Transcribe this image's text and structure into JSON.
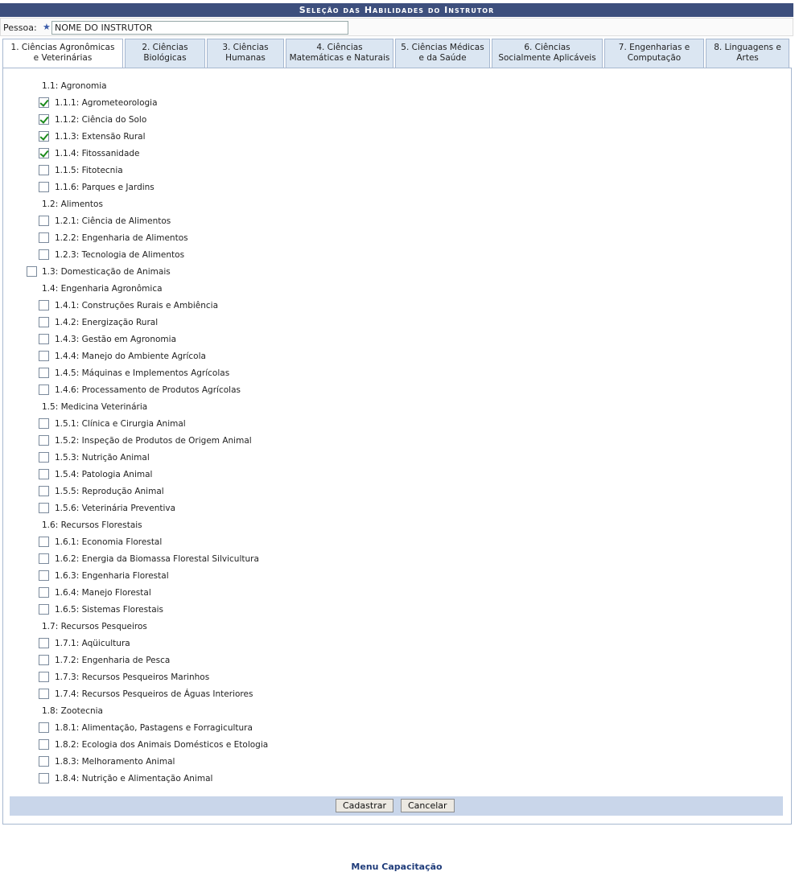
{
  "header": {
    "title": "Seleção das Habilidades do Instrutor"
  },
  "pessoa": {
    "label": "Pessoa:",
    "value": "NOME DO INSTRUTOR"
  },
  "tabs": [
    {
      "line1": "1. Ciências Agronômicas",
      "line2": "e Veterinárias",
      "active": true
    },
    {
      "line1": "2. Ciências",
      "line2": "Biológicas"
    },
    {
      "line1": "3. Ciências",
      "line2": "Humanas"
    },
    {
      "line1": "4. Ciências",
      "line2": "Matemáticas e Naturais"
    },
    {
      "line1": "5. Ciências Médicas",
      "line2": "e da Saúde"
    },
    {
      "line1": "6. Ciências",
      "line2": "Socialmente Aplicáveis"
    },
    {
      "line1": "7. Engenharias e",
      "line2": "Computação"
    },
    {
      "line1": "8. Linguagens e",
      "line2": "Artes"
    }
  ],
  "items": [
    {
      "label": "1.1: Agronomia",
      "kind": "group"
    },
    {
      "label": "1.1.1: Agrometeorologia",
      "kind": "item",
      "checked": true
    },
    {
      "label": "1.1.2: Ciência do Solo",
      "kind": "item",
      "checked": true
    },
    {
      "label": "1.1.3: Extensão Rural",
      "kind": "item",
      "checked": true
    },
    {
      "label": "1.1.4: Fitossanidade",
      "kind": "item",
      "checked": true
    },
    {
      "label": "1.1.5: Fitotecnia",
      "kind": "item",
      "checked": false
    },
    {
      "label": "1.1.6: Parques e Jardins",
      "kind": "item",
      "checked": false
    },
    {
      "label": "1.2: Alimentos",
      "kind": "group"
    },
    {
      "label": "1.2.1: Ciência de Alimentos",
      "kind": "item",
      "checked": false
    },
    {
      "label": "1.2.2: Engenharia de Alimentos",
      "kind": "item",
      "checked": false
    },
    {
      "label": "1.2.3: Tecnologia de Alimentos",
      "kind": "item",
      "checked": false
    },
    {
      "label": "1.3: Domesticação de Animais",
      "kind": "group-check",
      "checked": false
    },
    {
      "label": "1.4: Engenharia Agronômica",
      "kind": "group"
    },
    {
      "label": "1.4.1: Construções Rurais e Ambiência",
      "kind": "item",
      "checked": false
    },
    {
      "label": "1.4.2: Energização Rural",
      "kind": "item",
      "checked": false
    },
    {
      "label": "1.4.3: Gestão em Agronomia",
      "kind": "item",
      "checked": false
    },
    {
      "label": "1.4.4: Manejo do Ambiente Agrícola",
      "kind": "item",
      "checked": false
    },
    {
      "label": "1.4.5: Máquinas e Implementos Agrícolas",
      "kind": "item",
      "checked": false
    },
    {
      "label": "1.4.6: Processamento de Produtos Agrícolas",
      "kind": "item",
      "checked": false
    },
    {
      "label": "1.5: Medicina Veterinária",
      "kind": "group"
    },
    {
      "label": "1.5.1: Clínica e Cirurgia Animal",
      "kind": "item",
      "checked": false
    },
    {
      "label": "1.5.2: Inspeção de Produtos de Origem Animal",
      "kind": "item",
      "checked": false
    },
    {
      "label": "1.5.3: Nutrição Animal",
      "kind": "item",
      "checked": false
    },
    {
      "label": "1.5.4: Patologia Animal",
      "kind": "item",
      "checked": false
    },
    {
      "label": "1.5.5: Reprodução Animal",
      "kind": "item",
      "checked": false
    },
    {
      "label": "1.5.6: Veterinária Preventiva",
      "kind": "item",
      "checked": false
    },
    {
      "label": "1.6: Recursos Florestais",
      "kind": "group"
    },
    {
      "label": "1.6.1: Economia Florestal",
      "kind": "item",
      "checked": false
    },
    {
      "label": "1.6.2: Energia da Biomassa Florestal Silvicultura",
      "kind": "item",
      "checked": false
    },
    {
      "label": "1.6.3: Engenharia Florestal",
      "kind": "item",
      "checked": false
    },
    {
      "label": "1.6.4: Manejo Florestal",
      "kind": "item",
      "checked": false
    },
    {
      "label": "1.6.5: Sistemas Florestais",
      "kind": "item",
      "checked": false
    },
    {
      "label": "1.7: Recursos Pesqueiros",
      "kind": "group"
    },
    {
      "label": "1.7.1: Aqüicultura",
      "kind": "item",
      "checked": false
    },
    {
      "label": "1.7.2: Engenharia de Pesca",
      "kind": "item",
      "checked": false
    },
    {
      "label": "1.7.3: Recursos Pesqueiros Marinhos",
      "kind": "item",
      "checked": false
    },
    {
      "label": "1.7.4: Recursos Pesqueiros de Águas Interiores",
      "kind": "item",
      "checked": false
    },
    {
      "label": "1.8: Zootecnia",
      "kind": "group"
    },
    {
      "label": "1.8.1: Alimentação, Pastagens e Forragicultura",
      "kind": "item",
      "checked": false
    },
    {
      "label": "1.8.2: Ecologia dos Animais Domésticos e Etologia",
      "kind": "item",
      "checked": false
    },
    {
      "label": "1.8.3: Melhoramento Animal",
      "kind": "item",
      "checked": false
    },
    {
      "label": "1.8.4: Nutrição e Alimentação Animal",
      "kind": "item",
      "checked": false
    }
  ],
  "buttons": {
    "submit": "Cadastrar",
    "cancel": "Cancelar"
  },
  "footer": {
    "menu_link": "Menu Capacitação"
  },
  "colors": {
    "title_bg": "#3d4f7d",
    "tab_bg": "#dbe6f2",
    "footer_bg": "#c9d6ea",
    "link": "#1f3c7a"
  }
}
